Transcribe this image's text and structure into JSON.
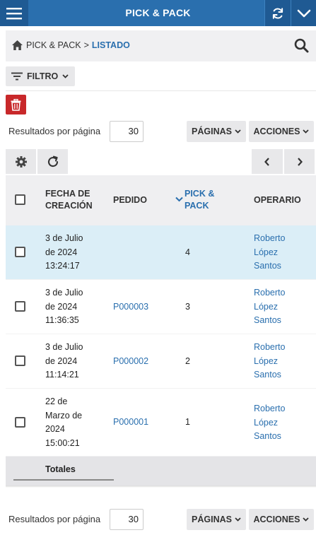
{
  "header": {
    "title": "PICK & PACK"
  },
  "breadcrumb": {
    "root": "PICK & PACK",
    "separator": ">",
    "current": "LISTADO"
  },
  "filter": {
    "label": "FILTRO"
  },
  "pagination": {
    "results_label": "Resultados por página",
    "per_page": "30",
    "pages_label": "PÁGINAS",
    "actions_label": "ACCIONES"
  },
  "table": {
    "columns": {
      "date": "FECHA DE CREACIÓN",
      "order": "PEDIDO",
      "pickpack": "PICK & PACK",
      "operator": "OPERARIO"
    },
    "sort_column": "pickpack",
    "rows": [
      {
        "date": "3 de Julio de 2024 13:24:17",
        "order": "",
        "pickpack": "4",
        "operator": "Roberto López Santos",
        "selected": true
      },
      {
        "date": "3 de Julio de 2024 11:36:35",
        "order": "P000003",
        "pickpack": "3",
        "operator": "Roberto López Santos",
        "selected": false
      },
      {
        "date": "3 de Julio de 2024 11:14:21",
        "order": "P000002",
        "pickpack": "2",
        "operator": "Roberto López Santos",
        "selected": false
      },
      {
        "date": "22 de Marzo de 2024 15:00:21",
        "order": "P000001",
        "pickpack": "1",
        "operator": "Roberto López Santos",
        "selected": false
      }
    ],
    "footer_label": "Totales"
  },
  "colors": {
    "primary": "#2a6fae",
    "primary_dark": "#1f5a93",
    "danger": "#c8282a",
    "selected_row": "#dbeef7"
  }
}
